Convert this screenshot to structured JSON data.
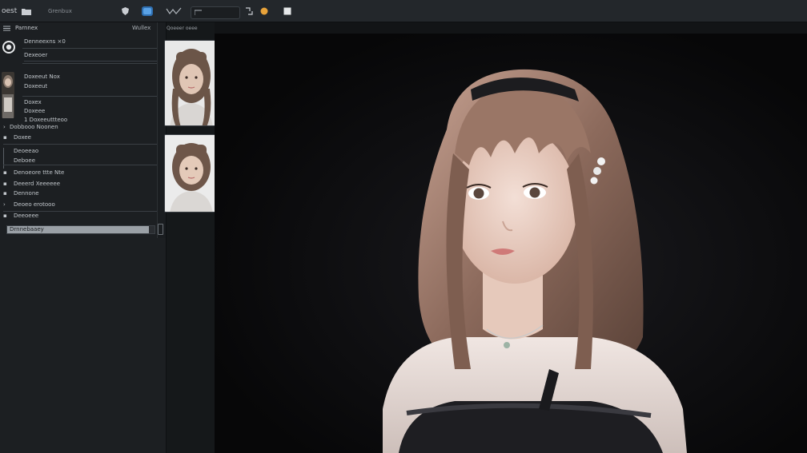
{
  "topbar": {
    "left_label": "oest",
    "menu_1": "Grenbux"
  },
  "left_panel": {
    "header_title": "Parnnex",
    "header_right": "Wullex",
    "rows": [
      {
        "label": "Denneexns ×0"
      },
      {
        "label": "Dexeoer"
      },
      {
        "label": "Doxeeut Nox"
      },
      {
        "label": "Doxeeut"
      },
      {
        "label": "Doxex"
      },
      {
        "label": "Doxeee"
      },
      {
        "label": "1 Doxeeuttteoo"
      },
      {
        "label": "Dobbooo Noonen"
      },
      {
        "label": "Doxee"
      },
      {
        "label": "Deoeeao"
      },
      {
        "label": "Deboee"
      },
      {
        "label": "Denoeore ttte Nte"
      },
      {
        "label": "Deeerd Xeeeeee"
      },
      {
        "label": "Dennone"
      },
      {
        "label": "Deoeo erotooo"
      },
      {
        "label": "Deeoeee"
      }
    ],
    "progress_value": 0.96,
    "progress_text": "Drnnebaaey"
  },
  "mid_column": {
    "header": "Qoeeer oeee"
  },
  "colors": {
    "accent_blue": "#3d8bd9",
    "accent_orange": "#e8a33a",
    "panel_bg": "#1c1f22",
    "topbar_bg": "#23272b"
  },
  "icons": [
    "grid-icon",
    "folder-icon",
    "shield-icon",
    "toggle-icon",
    "wave-icon",
    "sync-icon",
    "circle-icon",
    "square-icon",
    "radio-icon",
    "arrow-icon"
  ]
}
